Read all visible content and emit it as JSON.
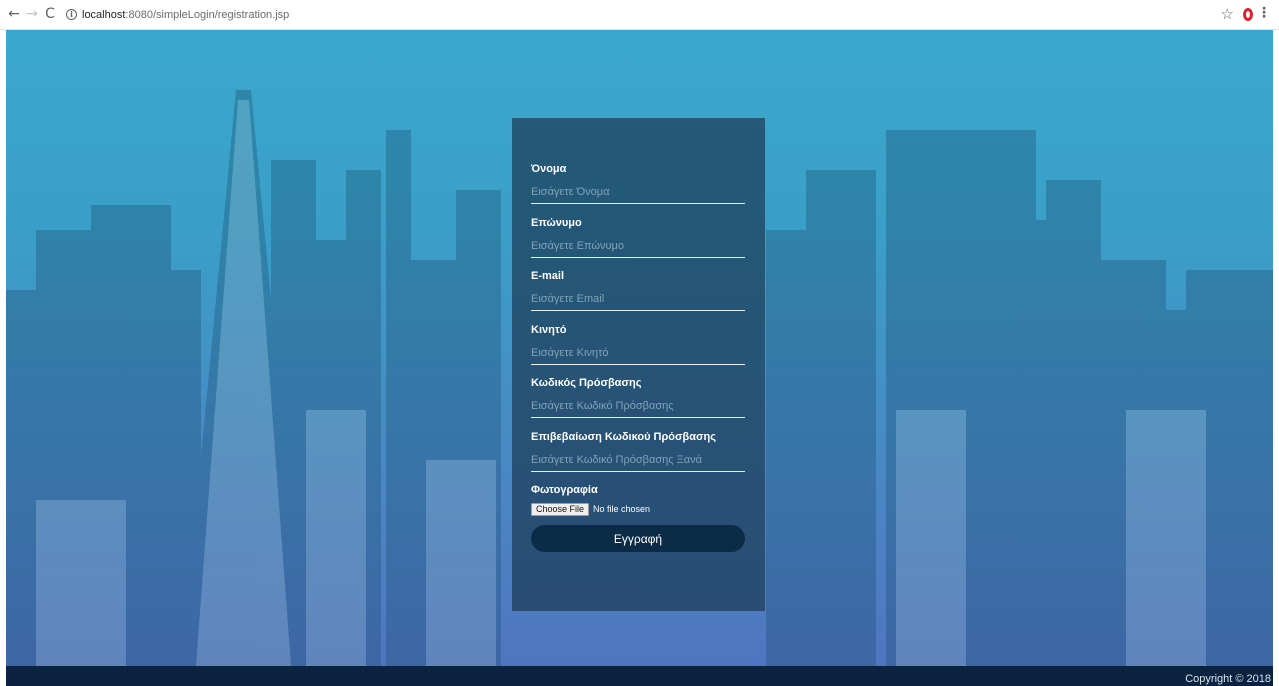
{
  "browser": {
    "back_glyph": "←",
    "forward_glyph": "→",
    "reload_glyph": "C",
    "info_glyph": "i",
    "url_host": "localhost",
    "url_path": ":8080/simpleLogin/registration.jsp",
    "star_glyph": "☆",
    "menu_glyph": "⋮"
  },
  "form": {
    "fields": [
      {
        "label": "Όνομα",
        "placeholder": "Εισάγετε Όνομα"
      },
      {
        "label": "Επώνυμο",
        "placeholder": "Εισάγετε Επώνυμο"
      },
      {
        "label": "E-mail",
        "placeholder": "Εισάγετε Email"
      },
      {
        "label": "Κινητό",
        "placeholder": "Εισάγετε Κινητό"
      },
      {
        "label": "Κωδικός Πρόσβασης",
        "placeholder": "Εισάγετε Κωδικό Πρόσβασης"
      },
      {
        "label": "Επιβεβαίωση Κωδικού Πρόσβασης",
        "placeholder": "Εισάγετε Κωδικό Πρόσβασης Ξανά"
      }
    ],
    "photo": {
      "label": "Φωτογραφία",
      "button_label": "Choose File",
      "status": "No file chosen"
    },
    "submit_label": "Εγγραφή"
  },
  "footer": {
    "copyright": "Copyright © 2018"
  },
  "colors": {
    "panel": "#1c3c58",
    "button": "#0c2b47",
    "footer": "#0b2240"
  }
}
